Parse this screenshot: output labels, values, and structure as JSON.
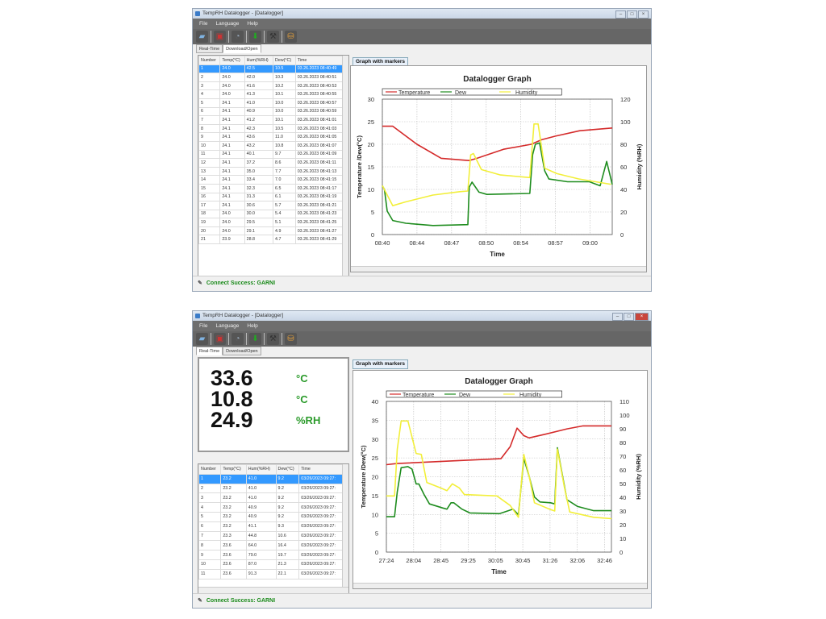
{
  "windows": [
    {
      "title": "TempRH Datalogger - [Datalogger]",
      "menu": [
        "File",
        "Language",
        "Help"
      ],
      "toolbar_icons": [
        "open-folder-icon",
        "save-icon",
        "clock-icon",
        "download-icon",
        "tools-icon",
        "database-icon"
      ],
      "tabs": [
        "Real-Time",
        "Download/Open"
      ],
      "active_tab": 1,
      "graph_tab": "Graph with markers",
      "status": "Connect Success: GARNI",
      "table": {
        "columns": [
          "Number",
          "Temp(°C)",
          "Hum(%RH)",
          "Dew(°C)",
          "Time"
        ],
        "selected_row": 0,
        "rows": [
          [
            "1",
            "24.0",
            "42.5",
            "10.5",
            "03.26.2023 08:40:49"
          ],
          [
            "2",
            "24.0",
            "42.0",
            "10.3",
            "03.26.2023 08:40:51"
          ],
          [
            "3",
            "24.0",
            "41.6",
            "10.2",
            "03.26.2023 08:40:53"
          ],
          [
            "4",
            "24.0",
            "41.3",
            "10.1",
            "03.26.2023 08:40:55"
          ],
          [
            "5",
            "24.1",
            "41.0",
            "10.0",
            "03.26.2023 08:40:57"
          ],
          [
            "6",
            "24.1",
            "40.9",
            "10.0",
            "03.26.2023 08:40:59"
          ],
          [
            "7",
            "24.1",
            "41.2",
            "10.1",
            "03.26.2023 08:41:01"
          ],
          [
            "8",
            "24.1",
            "42.3",
            "10.5",
            "03.26.2023 08:41:03"
          ],
          [
            "9",
            "24.1",
            "43.6",
            "11.0",
            "03.26.2023 08:41:05"
          ],
          [
            "10",
            "24.1",
            "43.2",
            "10.8",
            "03.26.2023 08:41:07"
          ],
          [
            "11",
            "24.1",
            "40.1",
            "9.7",
            "03.26.2023 08:41:09"
          ],
          [
            "12",
            "24.1",
            "37.2",
            "8.6",
            "03.26.2023 08:41:11"
          ],
          [
            "13",
            "24.1",
            "35.0",
            "7.7",
            "03.26.2023 08:41:13"
          ],
          [
            "14",
            "24.1",
            "33.4",
            "7.0",
            "03.26.2023 08:41:15"
          ],
          [
            "15",
            "24.1",
            "32.3",
            "6.5",
            "03.26.2023 08:41:17"
          ],
          [
            "16",
            "24.1",
            "31.3",
            "6.1",
            "03.26.2023 08:41:19"
          ],
          [
            "17",
            "24.1",
            "30.6",
            "5.7",
            "03.26.2023 08:41:21"
          ],
          [
            "18",
            "24.0",
            "30.0",
            "5.4",
            "03.26.2023 08:41:23"
          ],
          [
            "19",
            "24.0",
            "29.5",
            "5.1",
            "03.26.2023 08:41:25"
          ],
          [
            "20",
            "24.0",
            "29.1",
            "4.9",
            "03.26.2023 08:41:27"
          ],
          [
            "21",
            "23.9",
            "28.8",
            "4.7",
            "03.26.2023 08:41:29"
          ]
        ]
      }
    },
    {
      "title": "TempRH Datalogger - [Datalogger]",
      "menu": [
        "File",
        "Language",
        "Help"
      ],
      "toolbar_icons": [
        "open-folder-icon",
        "save-icon",
        "clock-icon",
        "download-icon",
        "tools-icon",
        "database-icon"
      ],
      "tabs": [
        "Real-Time",
        "Download/Open"
      ],
      "active_tab": 0,
      "graph_tab": "Graph with markers",
      "status": "Connect Success: GARNI",
      "realtime": [
        {
          "value": "33.6",
          "unit": "°C"
        },
        {
          "value": "10.8",
          "unit": "°C"
        },
        {
          "value": "24.9",
          "unit": "%RH"
        }
      ],
      "table": {
        "columns": [
          "Number",
          "Temp(°C)",
          "Hum(%RH)",
          "Dew(°C)",
          "Time"
        ],
        "selected_row": 0,
        "rows": [
          [
            "1",
            "23.2",
            "41.0",
            "9.2",
            "03/26/2023 09:27:"
          ],
          [
            "2",
            "23.2",
            "41.0",
            "9.2",
            "03/26/2023 09:27:"
          ],
          [
            "3",
            "23.2",
            "41.0",
            "9.2",
            "03/26/2023 09:27:"
          ],
          [
            "4",
            "23.2",
            "40.9",
            "9.2",
            "03/26/2023 09:27:"
          ],
          [
            "5",
            "23.2",
            "40.9",
            "9.2",
            "03/26/2023 09:27:"
          ],
          [
            "6",
            "23.2",
            "41.1",
            "9.3",
            "03/26/2023 09:27:"
          ],
          [
            "7",
            "23.3",
            "44.8",
            "10.6",
            "03/26/2023 09:27:"
          ],
          [
            "8",
            "23.6",
            "64.0",
            "16.4",
            "03/26/2023 09:27:"
          ],
          [
            "9",
            "23.6",
            "79.0",
            "19.7",
            "03/26/2023 09:27:"
          ],
          [
            "10",
            "23.6",
            "87.0",
            "21.3",
            "03/26/2023 09:27:"
          ],
          [
            "11",
            "23.6",
            "91.3",
            "22.1",
            "03/26/2023 09:27:"
          ]
        ]
      }
    }
  ],
  "colors": {
    "temperature": "#d42a2a",
    "dew": "#1e8c1e",
    "humidity": "#f2ef3a",
    "status": "#1a8a1a"
  },
  "chart_data": [
    {
      "type": "line",
      "title": "Datalogger Graph",
      "xlabel": "Time",
      "ylabel": "Temperature /Dew(°C)",
      "y2label": "Humidity (%RH)",
      "x_unit": "tick index",
      "xticks": [
        "08:40",
        "08:44",
        "08:47",
        "08:50",
        "08:54",
        "08:57",
        "09:00"
      ],
      "xlim": [
        0,
        6.64
      ],
      "ylim": [
        0,
        30
      ],
      "yticks": [
        0,
        5,
        10,
        15,
        20,
        25,
        30
      ],
      "y2lim": [
        0,
        120
      ],
      "y2ticks": [
        0,
        20,
        40,
        60,
        80,
        100,
        120
      ],
      "grid": true,
      "legend": [
        "Temperature",
        "Dew",
        "Humidity"
      ],
      "series": [
        {
          "name": "Temperature",
          "axis": "left",
          "points": [
            [
              0,
              24
            ],
            [
              0.3,
              24
            ],
            [
              1,
              20
            ],
            [
              1.7,
              16.9
            ],
            [
              2.5,
              16.4
            ],
            [
              2.7,
              16.8
            ],
            [
              3.5,
              18.9
            ],
            [
              4.3,
              20
            ],
            [
              4.6,
              21
            ],
            [
              5,
              21.8
            ],
            [
              5.7,
              23
            ],
            [
              6.64,
              23.6
            ]
          ]
        },
        {
          "name": "Dew",
          "axis": "left",
          "points": [
            [
              0,
              10.8
            ],
            [
              0.06,
              10
            ],
            [
              0.14,
              5.2
            ],
            [
              0.3,
              3.1
            ],
            [
              0.68,
              2.5
            ],
            [
              1.46,
              2.0
            ],
            [
              2.47,
              2.2
            ],
            [
              2.51,
              10.5
            ],
            [
              2.59,
              11.6
            ],
            [
              2.79,
              9.4
            ],
            [
              3.02,
              8.9
            ],
            [
              4.26,
              9.1
            ],
            [
              4.34,
              17.7
            ],
            [
              4.42,
              20
            ],
            [
              4.54,
              20.3
            ],
            [
              4.69,
              14.1
            ],
            [
              4.81,
              12.3
            ],
            [
              5.35,
              11.7
            ],
            [
              5.98,
              11.7
            ],
            [
              6.29,
              10.8
            ],
            [
              6.48,
              16.2
            ],
            [
              6.64,
              11.1
            ]
          ]
        },
        {
          "name": "Humidity",
          "axis": "right",
          "points": [
            [
              0,
              43.4
            ],
            [
              0.3,
              25.6
            ],
            [
              0.68,
              29
            ],
            [
              1.46,
              35
            ],
            [
              2.24,
              38
            ],
            [
              2.47,
              38.6
            ],
            [
              2.55,
              70.6
            ],
            [
              2.63,
              71.8
            ],
            [
              2.86,
              57.6
            ],
            [
              3.41,
              52.8
            ],
            [
              4.26,
              50.5
            ],
            [
              4.38,
              98
            ],
            [
              4.5,
              98
            ],
            [
              4.69,
              58.8
            ],
            [
              5.04,
              54
            ],
            [
              5.67,
              49.3
            ],
            [
              6.37,
              45.7
            ],
            [
              6.6,
              44.5
            ]
          ]
        }
      ]
    },
    {
      "type": "line",
      "title": "Datalogger Graph",
      "xlabel": "Time",
      "ylabel": "Temperature /Dew(°C)",
      "y2label": "Humidity (%RH)",
      "x_unit": "tick index",
      "xticks": [
        "27:24",
        "28:04",
        "28:45",
        "29:25",
        "30:05",
        "30:45",
        "31:26",
        "32:06",
        "32:46"
      ],
      "xlim": [
        0,
        8.25
      ],
      "ylim": [
        0,
        40
      ],
      "yticks": [
        0,
        5,
        10,
        15,
        20,
        25,
        30,
        35,
        40
      ],
      "y2lim": [
        0,
        110
      ],
      "y2ticks": [
        0,
        10,
        20,
        30,
        40,
        50,
        60,
        70,
        80,
        90,
        100,
        110
      ],
      "grid": true,
      "legend": [
        "Temperature",
        "Dew",
        "Humidity"
      ],
      "series": [
        {
          "name": "Temperature",
          "axis": "left",
          "points": [
            [
              0,
              23.2
            ],
            [
              0.4,
              23.5
            ],
            [
              2.67,
              24.3
            ],
            [
              4.2,
              24.8
            ],
            [
              4.54,
              28
            ],
            [
              4.79,
              32.9
            ],
            [
              5.04,
              30.9
            ],
            [
              5.23,
              30.3
            ],
            [
              5.83,
              31.3
            ],
            [
              6.62,
              32.7
            ],
            [
              7.21,
              33.5
            ],
            [
              8.25,
              33.5
            ]
          ]
        },
        {
          "name": "Dew",
          "axis": "left",
          "points": [
            [
              0,
              9.4
            ],
            [
              0.3,
              9.4
            ],
            [
              0.4,
              16
            ],
            [
              0.54,
              22.4
            ],
            [
              0.79,
              22.7
            ],
            [
              0.94,
              22
            ],
            [
              1.09,
              18.1
            ],
            [
              1.19,
              18.1
            ],
            [
              1.38,
              15.3
            ],
            [
              1.58,
              12.8
            ],
            [
              2.07,
              11.7
            ],
            [
              2.22,
              11.4
            ],
            [
              2.37,
              13.1
            ],
            [
              2.47,
              13.1
            ],
            [
              2.77,
              11.4
            ],
            [
              3.06,
              10.4
            ],
            [
              4.15,
              10.2
            ],
            [
              4.64,
              11.4
            ],
            [
              4.84,
              9.9
            ],
            [
              5.04,
              24.9
            ],
            [
              5.23,
              20.2
            ],
            [
              5.43,
              14.6
            ],
            [
              5.63,
              13.3
            ],
            [
              6.02,
              13.1
            ],
            [
              6.17,
              12.8
            ],
            [
              6.27,
              27.7
            ],
            [
              6.42,
              21.7
            ],
            [
              6.62,
              13.9
            ],
            [
              7.01,
              12.1
            ],
            [
              7.6,
              11
            ],
            [
              8.25,
              11
            ]
          ]
        },
        {
          "name": "Humidity",
          "axis": "right",
          "points": [
            [
              0,
              41
            ],
            [
              0.3,
              41
            ],
            [
              0.4,
              75
            ],
            [
              0.54,
              95.7
            ],
            [
              0.79,
              95.7
            ],
            [
              1.09,
              72
            ],
            [
              1.28,
              71.3
            ],
            [
              1.48,
              50.8
            ],
            [
              1.98,
              46.9
            ],
            [
              2.22,
              44.9
            ],
            [
              2.42,
              49.8
            ],
            [
              2.67,
              46.9
            ],
            [
              2.86,
              42
            ],
            [
              4.05,
              41
            ],
            [
              4.54,
              34
            ],
            [
              4.84,
              25.4
            ],
            [
              5.04,
              71.3
            ],
            [
              5.23,
              55.7
            ],
            [
              5.43,
              36
            ],
            [
              6.02,
              31
            ],
            [
              6.17,
              30
            ],
            [
              6.27,
              75.2
            ],
            [
              6.52,
              47.9
            ],
            [
              6.72,
              29.3
            ],
            [
              7.6,
              25.4
            ],
            [
              8.25,
              24.4
            ]
          ]
        }
      ]
    }
  ]
}
